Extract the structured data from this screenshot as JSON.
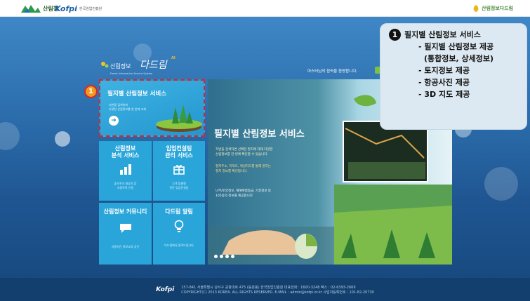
{
  "header": {
    "kfs_logo_text": "산림청",
    "kofpi_logo_text": "Kofpi",
    "kofpi_sub": "한국임업진흥원",
    "right_logo_text": "산림정보다드림"
  },
  "brand": {
    "title": "산림정보",
    "title_big": "다드림",
    "sup": "AI",
    "sub": "Forest Information Service System"
  },
  "welcome": "마스터님의 접속을 환영합니다.",
  "featured": {
    "badge": "1",
    "title": "필지별 산림정보 서비스",
    "desc1": "지번을 검색하여",
    "desc2": "다양한 산림정보를 한 번에 조회"
  },
  "tiles": [
    {
      "title1": "산림정보",
      "title2": "분석 서비스",
      "desc1": "숲가꾸기 대상지 등",
      "desc2": "조림목적 산정"
    },
    {
      "title1": "임업컨설팅",
      "title2": "관리 서비스",
      "desc1": "고객 맞춤형",
      "desc2": "전문 임업컨설팅"
    },
    {
      "title1": "산림정보 커뮤니티",
      "title2": "",
      "desc1": "사용자간 정보교류 공간",
      "desc2": ""
    },
    {
      "title1": "다드림 알림",
      "title2": "",
      "desc1": "다드림에서 알려드립니다",
      "desc2": ""
    }
  ],
  "banner": {
    "title": "필지별 산림정보 서비스",
    "line1": "지번을 검색하면 선택한 필지에 대해 다양한",
    "line2": "산림정보를 한 번에 확인할 수 있습니다.",
    "line3": "필지주소, 지적도, 위성지도를 통해 원하는",
    "line4": "필지 정보를 확인합니다.",
    "line5": "나무/토양정보, 재해위험등급, 기후정보 등",
    "line6": "105종의 정보를 제공합니다"
  },
  "callout": {
    "number": "1",
    "items": [
      "필지별 산림정보 서비스",
      "- 필지별 산림정보 제공",
      "(통합정보, 상세정보)",
      "- 토지정보 제공",
      "- 항공사진 제공",
      "- 3D 지도 제공"
    ]
  },
  "footer": {
    "logo": "Kofpi",
    "line1": "157-841 서울특별시 강서구 공항대로 475 (등촌동) 한국임업진흥원 대표전화 : 1600-3248 팩스 : 02-6393-2669",
    "line2": "COPYRIGHT(C) 2013 KOREA. ALL RIGHTS RESERVED. E-MAIL : admin@kofpi.or.kr 사업자등록번호 : 101-82-20730"
  },
  "colors": {
    "tile": "#2aa5da",
    "featured_border": "#d7262b",
    "badge": "#f29a1c",
    "callout_bg": "#dde9f2"
  }
}
